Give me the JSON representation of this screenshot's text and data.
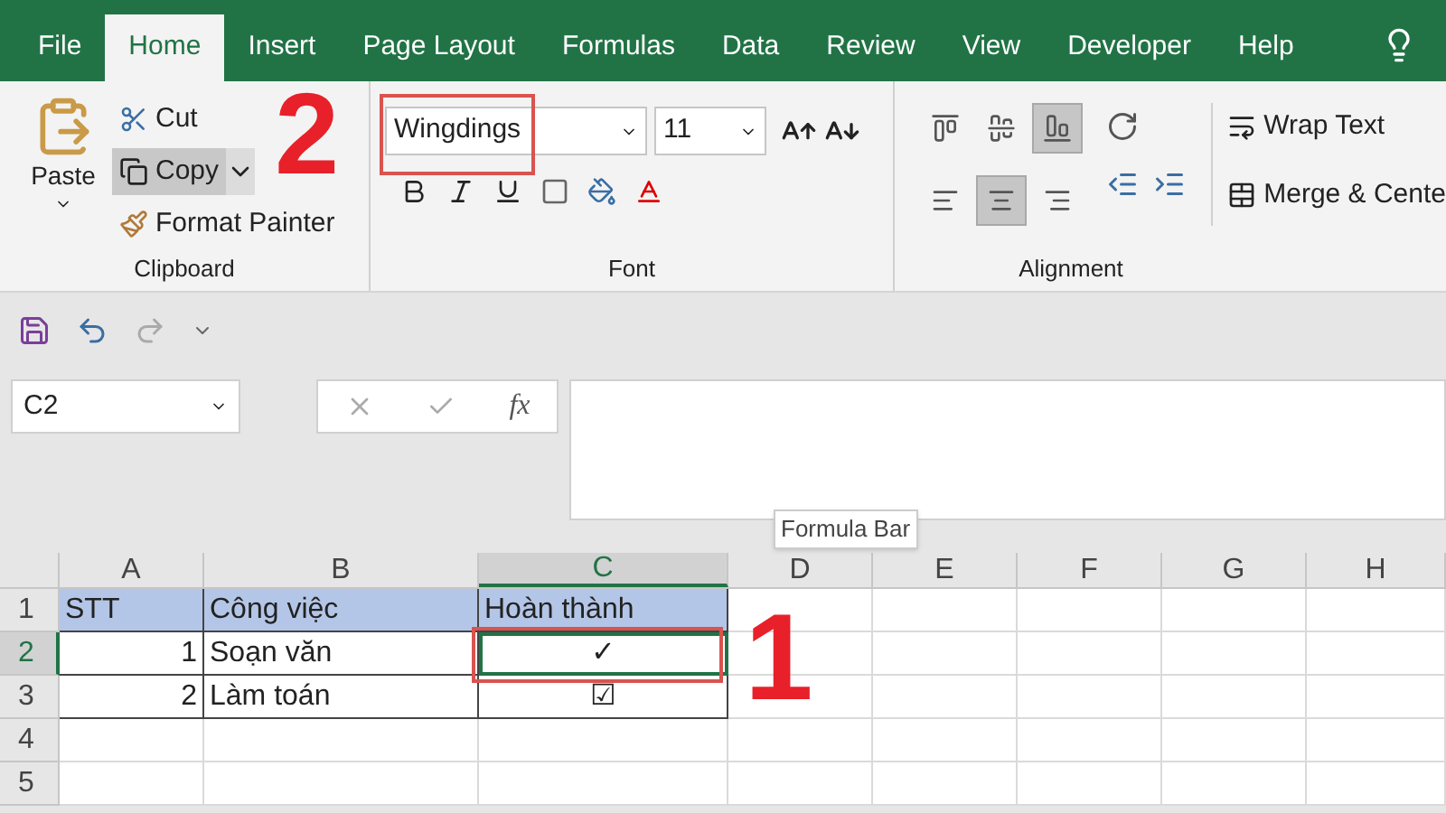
{
  "tabs": [
    {
      "label": "File",
      "selected": false
    },
    {
      "label": "Home",
      "selected": true
    },
    {
      "label": "Insert",
      "selected": false
    },
    {
      "label": "Page Layout",
      "selected": false
    },
    {
      "label": "Formulas",
      "selected": false
    },
    {
      "label": "Data",
      "selected": false
    },
    {
      "label": "Review",
      "selected": false
    },
    {
      "label": "View",
      "selected": false
    },
    {
      "label": "Developer",
      "selected": false
    },
    {
      "label": "Help",
      "selected": false
    }
  ],
  "clipboard": {
    "paste": "Paste",
    "cut": "Cut",
    "copy": "Copy",
    "format_painter": "Format Painter",
    "label": "Clipboard"
  },
  "font": {
    "font_name": "Wingdings",
    "font_size": "11",
    "label": "Font"
  },
  "alignment": {
    "buttons": [
      {
        "kind": "top",
        "selected": false
      },
      {
        "kind": "middle",
        "selected": false
      },
      {
        "kind": "bottom",
        "selected": true
      },
      {
        "kind": "left",
        "selected": false
      },
      {
        "kind": "center",
        "selected": true
      },
      {
        "kind": "right",
        "selected": false
      }
    ],
    "wrap_text": "Wrap Text",
    "merge": "Merge & Cente",
    "label": "Alignment"
  },
  "name_box": "C2",
  "function_label": "fx",
  "tooltip": "Formula Bar",
  "annotations": [
    "2",
    "1"
  ],
  "columns": [
    {
      "label": "A",
      "selected": false
    },
    {
      "label": "B",
      "selected": false
    },
    {
      "label": "C",
      "selected": true
    },
    {
      "label": "D",
      "selected": false
    },
    {
      "label": "E",
      "selected": false
    },
    {
      "label": "F",
      "selected": false
    },
    {
      "label": "G",
      "selected": false
    },
    {
      "label": "H",
      "selected": false
    }
  ],
  "rows": [
    {
      "label": "1",
      "selected": false,
      "cells": [
        {
          "text": "STT",
          "kind": "header"
        },
        {
          "text": "Công việc",
          "kind": "header"
        },
        {
          "text": "Hoàn thành",
          "kind": "header"
        }
      ]
    },
    {
      "label": "2",
      "selected": true,
      "cells": [
        {
          "text": "1",
          "kind": "number"
        },
        {
          "text": "Soạn văn",
          "kind": "text"
        },
        {
          "text": "✓",
          "kind": "symbol"
        }
      ]
    },
    {
      "label": "3",
      "selected": false,
      "cells": [
        {
          "text": "2",
          "kind": "number"
        },
        {
          "text": "Làm toán",
          "kind": "text"
        },
        {
          "text": "☑",
          "kind": "symbol"
        }
      ]
    },
    {
      "label": "4",
      "selected": false,
      "cells": []
    },
    {
      "label": "5",
      "selected": false,
      "cells": []
    }
  ]
}
